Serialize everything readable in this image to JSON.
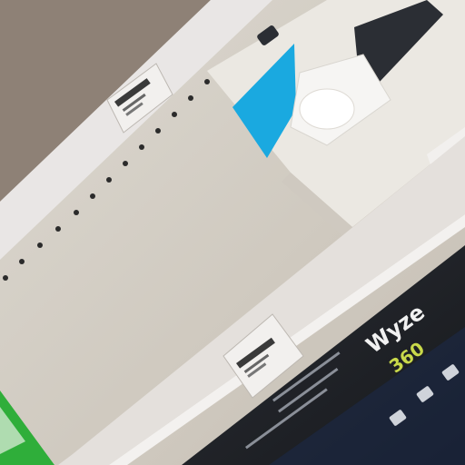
{
  "photo": {
    "subject": "",
    "box_brand_text": "Wyze",
    "box_model_text": "360",
    "colors": {
      "wall": "#8e8176",
      "shelf_strip": "#e9e6e5",
      "shelf_back": "#d6d1c8",
      "box_white": "#ebe8e2",
      "box_accent": "#1aa9e0",
      "box_dark": "#1f2228",
      "box_brand_green": "#c9d94a",
      "green_box": "#2fae3a"
    }
  }
}
